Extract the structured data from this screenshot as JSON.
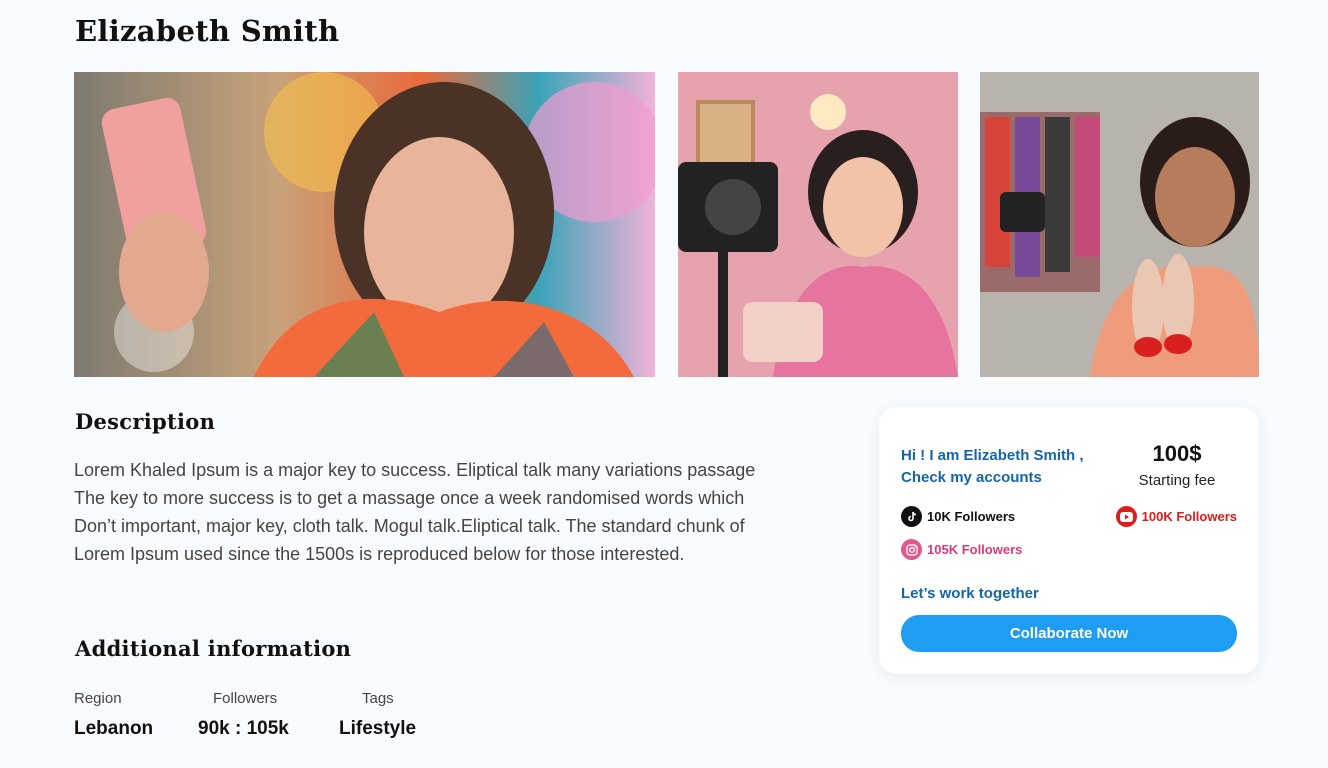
{
  "profile": {
    "name": "Elizabeth Smith"
  },
  "description": {
    "heading": "Description",
    "text": "Lorem Khaled Ipsum is a major key to success. Eliptical talk many variations passage The key to more success is to get a massage once a week randomised words which Don’t important, major key, cloth talk. Mogul talk.Eliptical talk. The standard chunk of Lorem Ipsum used since the 1500s is reproduced below for those interested."
  },
  "additional": {
    "heading": "Additional information",
    "region_label": "Region",
    "region_value": "Lebanon",
    "followers_label": "Followers",
    "followers_value": "90k : 105k",
    "tags_label": "Tags",
    "tags_value": "Lifestyle"
  },
  "card": {
    "greeting": "Hi ! I am Elizabeth Smith , Check my accounts",
    "fee_amount": "100$",
    "fee_label": "Starting fee",
    "tiktok": {
      "icon": "tiktok-icon",
      "label": "10K Followers",
      "color": "#111111"
    },
    "youtube": {
      "icon": "youtube-icon",
      "label": "100K Followers",
      "color": "#e01b1b"
    },
    "instagram": {
      "icon": "instagram-icon",
      "label": "105K Followers",
      "color": "#d63c78"
    },
    "cta_text": "Let’s work together",
    "button_label": "Collaborate Now"
  },
  "colors": {
    "accent_blue": "#1e9df2",
    "link_blue": "#1565a8",
    "background": "#f7fbfe"
  }
}
